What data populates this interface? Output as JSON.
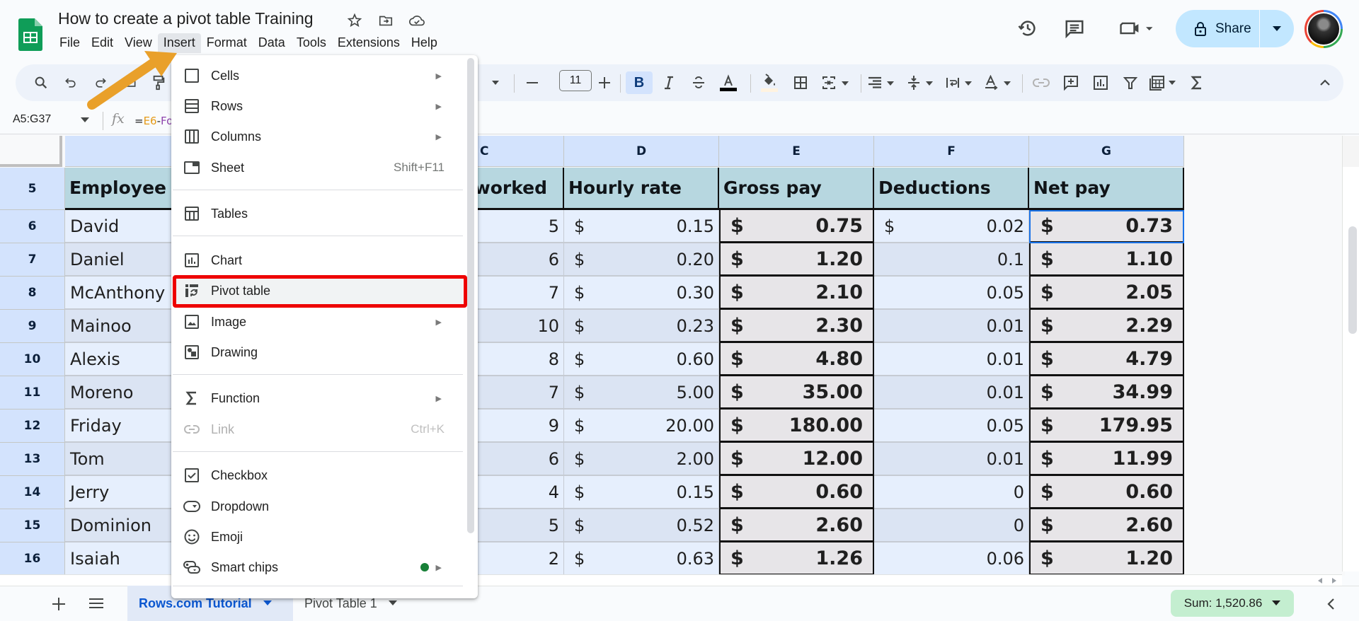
{
  "app": {
    "doc_title": "How to create a pivot table Training",
    "menus": [
      "File",
      "Edit",
      "View",
      "Insert",
      "Format",
      "Data",
      "Tools",
      "Extensions",
      "Help"
    ],
    "active_menu": "Insert",
    "share_label": "Share",
    "brand_color": "#0f9d58"
  },
  "toolbar": {
    "font_size": "11",
    "bold_active": true
  },
  "formula_bar": {
    "name_box": "A5:G37",
    "formula_prefix": "=",
    "formula_ref1": "E6",
    "formula_op": "-",
    "formula_ref2": "Fo"
  },
  "grid": {
    "columns": [
      "C",
      "D",
      "E",
      "F",
      "G"
    ],
    "header_row": {
      "row_number": "5",
      "A": "Employee n",
      "C": "worked",
      "D": "Hourly rate",
      "E": "Gross pay",
      "F": "Deductions",
      "G": "Net pay"
    },
    "rows": [
      {
        "n": "6",
        "name": "David",
        "hours": "5",
        "rate": "0.15",
        "gross": "0.75",
        "ded": "0.02",
        "ded_currency": "$",
        "net": "0.73"
      },
      {
        "n": "7",
        "name": "Daniel",
        "hours": "6",
        "rate": "0.20",
        "gross": "1.20",
        "ded": "0.1",
        "ded_currency": "",
        "net": "1.10"
      },
      {
        "n": "8",
        "name": "McAnthony",
        "hours": "7",
        "rate": "0.30",
        "gross": "2.10",
        "ded": "0.05",
        "ded_currency": "",
        "net": "2.05"
      },
      {
        "n": "9",
        "name": "Mainoo",
        "hours": "10",
        "rate": "0.23",
        "gross": "2.30",
        "ded": "0.01",
        "ded_currency": "",
        "net": "2.29"
      },
      {
        "n": "10",
        "name": "Alexis",
        "hours": "8",
        "rate": "0.60",
        "gross": "4.80",
        "ded": "0.01",
        "ded_currency": "",
        "net": "4.79"
      },
      {
        "n": "11",
        "name": "Moreno",
        "hours": "7",
        "rate": "5.00",
        "gross": "35.00",
        "ded": "0.01",
        "ded_currency": "",
        "net": "34.99"
      },
      {
        "n": "12",
        "name": "Friday",
        "hours": "9",
        "rate": "20.00",
        "gross": "180.00",
        "ded": "0.05",
        "ded_currency": "",
        "net": "179.95"
      },
      {
        "n": "13",
        "name": "Tom",
        "hours": "6",
        "rate": "2.00",
        "gross": "12.00",
        "ded": "0.01",
        "ded_currency": "",
        "net": "11.99"
      },
      {
        "n": "14",
        "name": "Jerry",
        "hours": "4",
        "rate": "0.15",
        "gross": "0.60",
        "ded": "0",
        "ded_currency": "",
        "net": "0.60"
      },
      {
        "n": "15",
        "name": "Dominion",
        "hours": "5",
        "rate": "0.52",
        "gross": "2.60",
        "ded": "0",
        "ded_currency": "",
        "net": "2.60"
      },
      {
        "n": "16",
        "name": "Isaiah",
        "hours": "2",
        "rate": "0.63",
        "gross": "1.26",
        "ded": "0.06",
        "ded_currency": "",
        "net": "1.20"
      }
    ],
    "currency_symbol": "$",
    "selected_cell": "G6"
  },
  "insert_menu": {
    "items": [
      {
        "label": "Cells",
        "icon": "cells-icon",
        "submenu": true
      },
      {
        "label": "Rows",
        "icon": "rows-icon",
        "submenu": true
      },
      {
        "label": "Columns",
        "icon": "columns-icon",
        "submenu": true
      },
      {
        "label": "Sheet",
        "icon": "sheet-icon",
        "shortcut": "Shift+F11"
      },
      {
        "label": "Tables",
        "icon": "tables-icon"
      },
      {
        "label": "Chart",
        "icon": "chart-icon"
      },
      {
        "label": "Pivot table",
        "icon": "pivot-table-icon",
        "highlighted": true
      },
      {
        "label": "Image",
        "icon": "image-icon",
        "submenu": true
      },
      {
        "label": "Drawing",
        "icon": "drawing-icon"
      },
      {
        "label": "Function",
        "icon": "sigma-icon",
        "submenu": true
      },
      {
        "label": "Link",
        "icon": "link-icon",
        "shortcut": "Ctrl+K",
        "disabled": true
      },
      {
        "label": "Checkbox",
        "icon": "checkbox-icon"
      },
      {
        "label": "Dropdown",
        "icon": "dropdown-icon"
      },
      {
        "label": "Emoji",
        "icon": "emoji-icon"
      },
      {
        "label": "Smart chips",
        "icon": "smart-chips-icon",
        "submenu": true,
        "new_badge": true
      }
    ]
  },
  "sheets": {
    "tabs": [
      "Rows.com Tutorial",
      "Pivot Table 1"
    ],
    "active": "Rows.com Tutorial"
  },
  "status": {
    "sum_label": "Sum: 1,520.86"
  },
  "annotation": {
    "arrow_color": "#e9a02a",
    "highlight_color": "#ee0000"
  }
}
